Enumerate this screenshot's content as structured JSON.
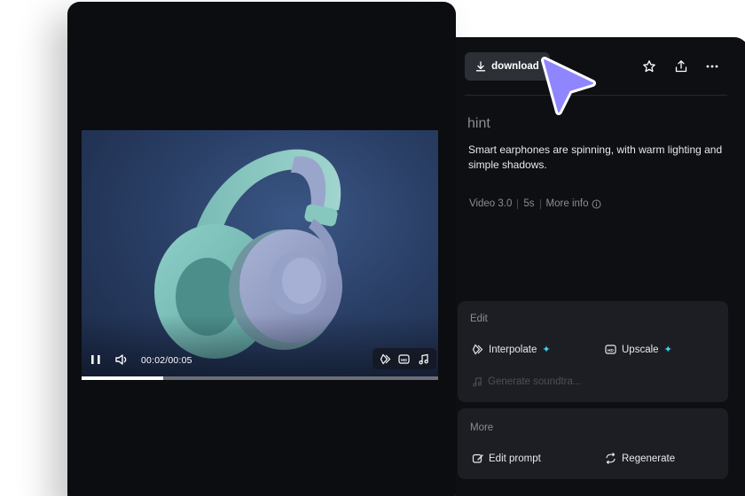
{
  "player": {
    "time": "00:02/00:05",
    "progress_fraction": 0.23,
    "icons": {
      "pause": "pause-icon",
      "volume": "volume-icon",
      "interpolate": "interpolate-icon",
      "hd": "hd-icon",
      "music": "music-note-icon"
    }
  },
  "panel": {
    "download_label": "download",
    "hint_title": "hint",
    "prompt": "Smart earphones are spinning, with warm lighting and simple shadows.",
    "meta": {
      "model": "Video 3.0",
      "duration": "5s",
      "more_info": "More info"
    },
    "edit": {
      "title": "Edit",
      "interpolate": "Interpolate",
      "upscale": "Upscale",
      "soundtrack": "Generate soundtra..."
    },
    "more": {
      "title": "More",
      "edit_prompt": "Edit prompt",
      "regenerate": "Regenerate"
    }
  },
  "colors": {
    "panel_bg": "#0e0f12",
    "card_bg": "#1c1e23",
    "accent_sparkle": "#3fd2f5",
    "cursor": "#8f86ff"
  }
}
